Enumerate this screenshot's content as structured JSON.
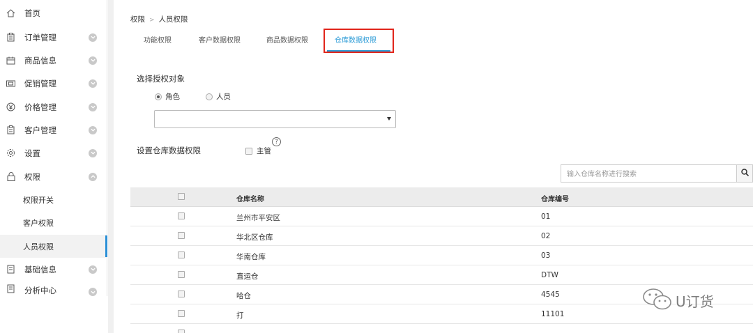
{
  "sidebar": {
    "items": [
      {
        "label": "首页",
        "icon": "home-icon"
      },
      {
        "label": "订单管理",
        "icon": "clipboard-icon"
      },
      {
        "label": "商品信息",
        "icon": "calendar-icon"
      },
      {
        "label": "促销管理",
        "icon": "ticket-icon"
      },
      {
        "label": "价格管理",
        "icon": "yen-icon"
      },
      {
        "label": "客户管理",
        "icon": "clipboard-icon"
      },
      {
        "label": "设置",
        "icon": "gear-icon"
      },
      {
        "label": "权限",
        "icon": "lock-icon"
      },
      {
        "label": "基础信息",
        "icon": "document-icon"
      },
      {
        "label": "分析中心",
        "icon": "document-icon"
      }
    ],
    "sub_items": [
      {
        "label": "权限开关"
      },
      {
        "label": "客户权限"
      },
      {
        "label": "人员权限"
      }
    ],
    "active_color": "#2a8fd6"
  },
  "breadcrumb": {
    "root": "权限",
    "separator": ">",
    "current": "人员权限"
  },
  "tabs": [
    {
      "label": "功能权限"
    },
    {
      "label": "客户数据权限"
    },
    {
      "label": "商品数据权限"
    },
    {
      "label": "仓库数据权限"
    }
  ],
  "form": {
    "select_target_label": "选择授权对象",
    "radio_role": "角色",
    "radio_person": "人员",
    "warehouse_perm_label": "设置仓库数据权限",
    "manager_label": "主管",
    "help_symbol": "?"
  },
  "search": {
    "placeholder": "输入仓库名称进行搜索"
  },
  "table": {
    "headers": {
      "name": "仓库名称",
      "code": "仓库编号"
    },
    "rows": [
      {
        "name": "兰州市平安区",
        "code": "01"
      },
      {
        "name": "华北区仓库",
        "code": "02"
      },
      {
        "name": "华南仓库",
        "code": "03"
      },
      {
        "name": "直运仓",
        "code": "DTW"
      },
      {
        "name": "哈仓",
        "code": "4545"
      },
      {
        "name": "打",
        "code": "11101"
      }
    ]
  },
  "watermark": {
    "text": "U订货",
    "icon": "wechat-icon"
  },
  "colors": {
    "highlight_box": "#e1251b",
    "tab_active": "#2a9ad6"
  }
}
